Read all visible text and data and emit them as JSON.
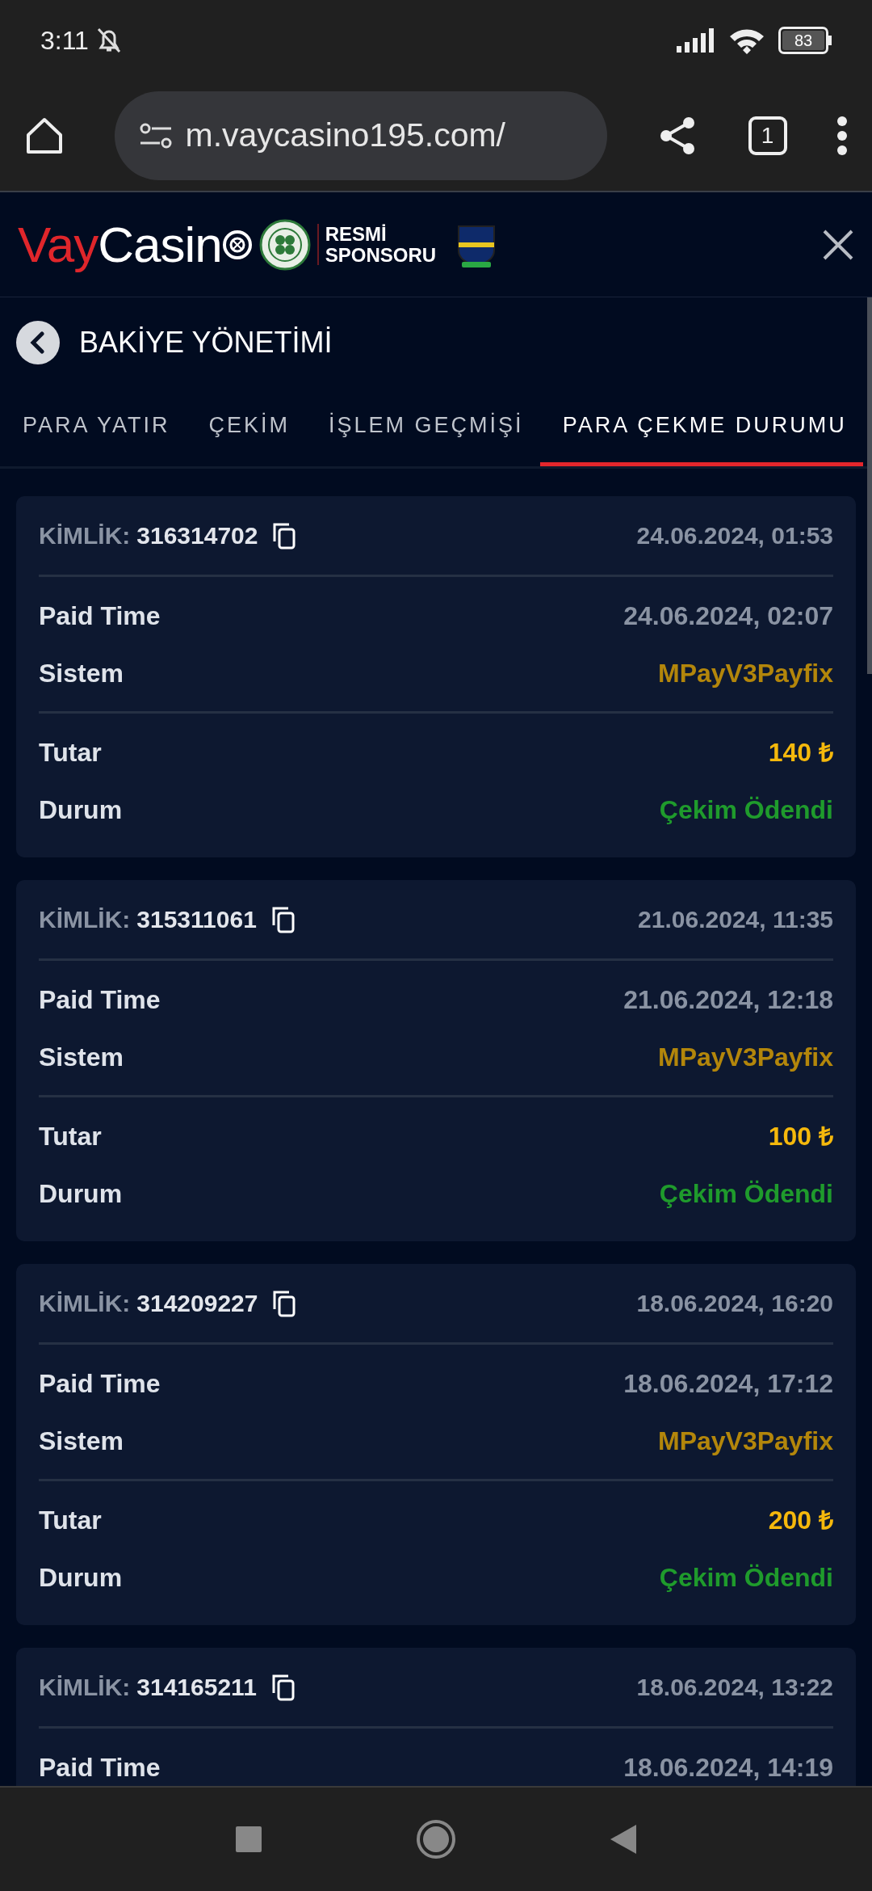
{
  "status_bar": {
    "time": "3:11",
    "battery": "83"
  },
  "browser": {
    "url": "m.vaycasino195.com/",
    "tab_count": "1"
  },
  "header": {
    "logo_first": "Vay",
    "logo_second": "Casin",
    "sponsor_lines": [
      "RESMİ",
      "SPONSORU"
    ]
  },
  "page_title": "BAKİYE YÖNETİMİ",
  "tabs": [
    {
      "label": "PARA YATIR",
      "selected": false
    },
    {
      "label": "ÇEKİM",
      "selected": false
    },
    {
      "label": "İŞLEM GEÇMİŞİ",
      "selected": false
    },
    {
      "label": "PARA ÇEKME DURUMU",
      "selected": true
    }
  ],
  "withdrawals": [
    {
      "id_label": "KİMLİK:",
      "id": "316314702",
      "created": "24.06.2024, 01:53",
      "groups": [
        [
          {
            "label": "Paid Time",
            "value": "24.06.2024, 02:07",
            "kind": "time"
          },
          {
            "label": "Sistem",
            "value": "MPayV3Payfix",
            "kind": "system"
          }
        ],
        [
          {
            "label": "Tutar",
            "value": "140 ₺",
            "kind": "amount"
          },
          {
            "label": "Durum",
            "value": "Çekim Ödendi",
            "kind": "status"
          }
        ]
      ]
    },
    {
      "id_label": "KİMLİK:",
      "id": "315311061",
      "created": "21.06.2024, 11:35",
      "groups": [
        [
          {
            "label": "Paid Time",
            "value": "21.06.2024, 12:18",
            "kind": "time"
          },
          {
            "label": "Sistem",
            "value": "MPayV3Payfix",
            "kind": "system"
          }
        ],
        [
          {
            "label": "Tutar",
            "value": "100 ₺",
            "kind": "amount"
          },
          {
            "label": "Durum",
            "value": "Çekim Ödendi",
            "kind": "status"
          }
        ]
      ]
    },
    {
      "id_label": "KİMLİK:",
      "id": "314209227",
      "created": "18.06.2024, 16:20",
      "groups": [
        [
          {
            "label": "Paid Time",
            "value": "18.06.2024, 17:12",
            "kind": "time"
          },
          {
            "label": "Sistem",
            "value": "MPayV3Payfix",
            "kind": "system"
          }
        ],
        [
          {
            "label": "Tutar",
            "value": "200 ₺",
            "kind": "amount"
          },
          {
            "label": "Durum",
            "value": "Çekim Ödendi",
            "kind": "status"
          }
        ]
      ]
    },
    {
      "id_label": "KİMLİK:",
      "id": "314165211",
      "created": "18.06.2024, 13:22",
      "groups": [
        [
          {
            "label": "Paid Time",
            "value": "18.06.2024, 14:19",
            "kind": "time"
          }
        ]
      ]
    }
  ]
}
